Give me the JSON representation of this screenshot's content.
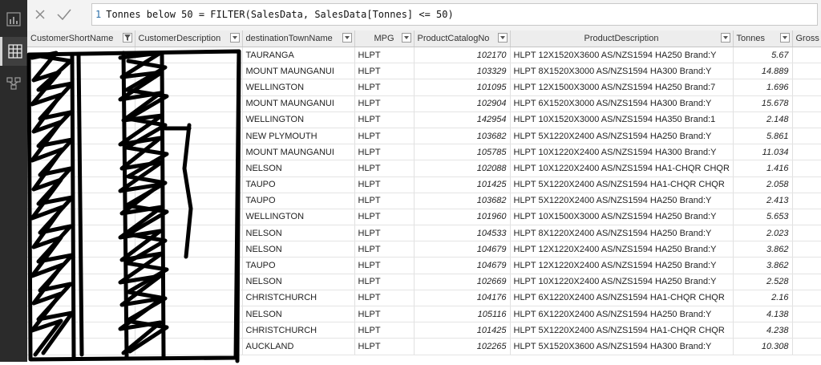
{
  "formula": {
    "line_number": "1",
    "text": "Tonnes below 50 = FILTER(SalesData, SalesData[Tonnes] <= 50)"
  },
  "rail_icons": [
    "report-view-icon",
    "data-view-icon",
    "model-view-icon"
  ],
  "columns": [
    {
      "key": "c1",
      "label": "CustomerShortName",
      "filtered": true
    },
    {
      "key": "c2",
      "label": "CustomerDescription",
      "filtered": false
    },
    {
      "key": "c3",
      "label": "destinationTownName",
      "filtered": false
    },
    {
      "key": "c4",
      "label": "MPG",
      "filtered": false
    },
    {
      "key": "c5",
      "label": "ProductCatalogNo",
      "filtered": false
    },
    {
      "key": "c6",
      "label": "ProductDescription",
      "filtered": false
    },
    {
      "key": "c7",
      "label": "Tonnes",
      "filtered": false
    },
    {
      "key": "c8",
      "label": "Gross",
      "filtered": false
    }
  ],
  "rows": [
    {
      "town": "TAURANGA",
      "mpg": "HLPT",
      "catalog": "102170",
      "desc": "HLPT 12X1520X3600 AS/NZS1594 HA250 Brand:Y",
      "tonnes": "5.67"
    },
    {
      "town": "MOUNT MAUNGANUI",
      "mpg": "HLPT",
      "catalog": "103329",
      "desc": "HLPT 8X1520X3000 AS/NZS1594 HA300 Brand:Y",
      "tonnes": "14.889"
    },
    {
      "town": "WELLINGTON",
      "mpg": "HLPT",
      "catalog": "101095",
      "desc": "HLPT 12X1500X3000 AS/NZS1594 HA250 Brand:7",
      "tonnes": "1.696"
    },
    {
      "town": "MOUNT MAUNGANUI",
      "mpg": "HLPT",
      "catalog": "102904",
      "desc": "HLPT 6X1520X3000 AS/NZS1594 HA300 Brand:Y",
      "tonnes": "15.678"
    },
    {
      "town": "WELLINGTON",
      "mpg": "HLPT",
      "catalog": "142954",
      "desc": "HLPT 10X1520X3000 AS/NZS1594 HA350 Brand:1",
      "tonnes": "2.148"
    },
    {
      "town": "NEW PLYMOUTH",
      "mpg": "HLPT",
      "catalog": "103682",
      "desc": "HLPT 5X1220X2400 AS/NZS1594 HA250 Brand:Y",
      "tonnes": "5.861"
    },
    {
      "town": "MOUNT MAUNGANUI",
      "mpg": "HLPT",
      "catalog": "105785",
      "desc": "HLPT 10X1220X2400 AS/NZS1594 HA300 Brand:Y",
      "tonnes": "11.034"
    },
    {
      "town": "NELSON",
      "mpg": "HLPT",
      "catalog": "102088",
      "desc": "HLPT 10X1220X2400 AS/NZS1594 HA1-CHQR CHQR",
      "tonnes": "1.416"
    },
    {
      "town": "TAUPO",
      "mpg": "HLPT",
      "catalog": "101425",
      "desc": "HLPT 5X1220X2400 AS/NZS1594 HA1-CHQR CHQR",
      "tonnes": "2.058"
    },
    {
      "town": "TAUPO",
      "mpg": "HLPT",
      "catalog": "103682",
      "desc": "HLPT 5X1220X2400 AS/NZS1594 HA250 Brand:Y",
      "tonnes": "2.413"
    },
    {
      "town": "WELLINGTON",
      "mpg": "HLPT",
      "catalog": "101960",
      "desc": "HLPT 10X1500X3000 AS/NZS1594 HA250 Brand:Y",
      "tonnes": "5.653"
    },
    {
      "town": "NELSON",
      "mpg": "HLPT",
      "catalog": "104533",
      "desc": "HLPT 8X1220X2400 AS/NZS1594 HA250 Brand:Y",
      "tonnes": "2.023"
    },
    {
      "town": "NELSON",
      "mpg": "HLPT",
      "catalog": "104679",
      "desc": "HLPT 12X1220X2400 AS/NZS1594 HA250 Brand:Y",
      "tonnes": "3.862"
    },
    {
      "town": "TAUPO",
      "mpg": "HLPT",
      "catalog": "104679",
      "desc": "HLPT 12X1220X2400 AS/NZS1594 HA250 Brand:Y",
      "tonnes": "3.862"
    },
    {
      "town": "NELSON",
      "mpg": "HLPT",
      "catalog": "102669",
      "desc": "HLPT 10X1220X2400 AS/NZS1594 HA250 Brand:Y",
      "tonnes": "2.528"
    },
    {
      "town": "CHRISTCHURCH",
      "mpg": "HLPT",
      "catalog": "104176",
      "desc": "HLPT 6X1220X2400 AS/NZS1594 HA1-CHQR CHQR",
      "tonnes": "2.16"
    },
    {
      "town": "NELSON",
      "mpg": "HLPT",
      "catalog": "105116",
      "desc": "HLPT 6X1220X2400 AS/NZS1594 HA250 Brand:Y",
      "tonnes": "4.138"
    },
    {
      "town": "CHRISTCHURCH",
      "mpg": "HLPT",
      "catalog": "101425",
      "desc": "HLPT 5X1220X2400 AS/NZS1594 HA1-CHQR CHQR",
      "tonnes": "4.238"
    },
    {
      "town": "AUCKLAND",
      "mpg": "HLPT",
      "catalog": "102265",
      "desc": "HLPT 5X1520X3600 AS/NZS1594 HA300 Brand:Y",
      "tonnes": "10.308"
    }
  ]
}
